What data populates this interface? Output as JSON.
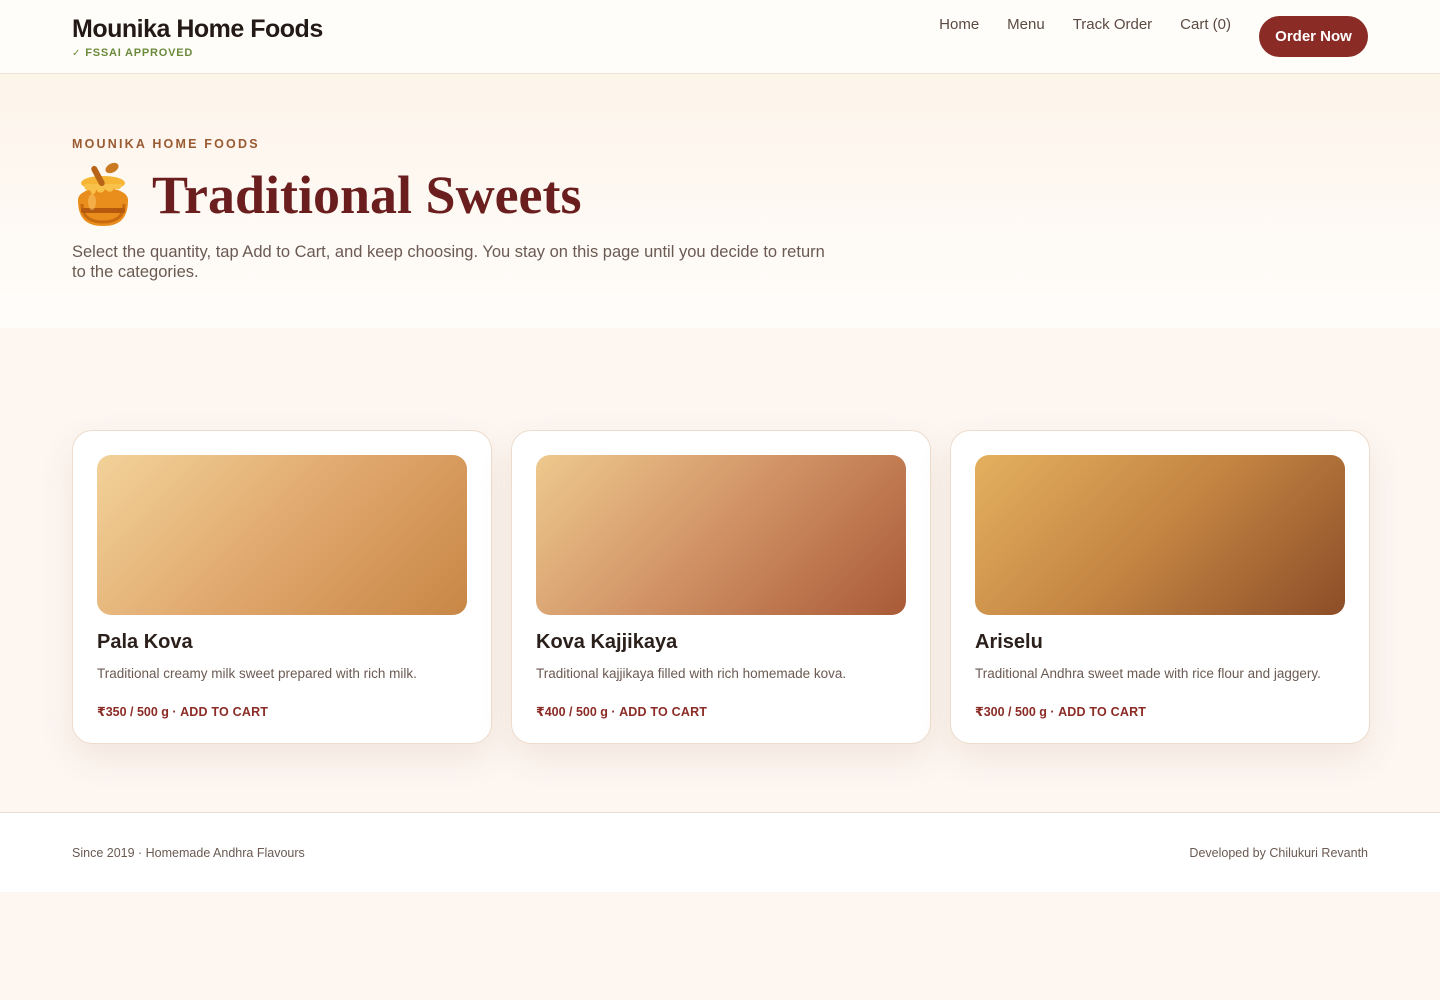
{
  "header": {
    "brand_name": "Mounika Home Foods",
    "badge": "FSSAI APPROVED",
    "nav": [
      "Home",
      "Menu",
      "Track Order",
      "Cart (0)"
    ],
    "cta": "Order Now"
  },
  "hero": {
    "eyebrow": "MOUNIKA HOME FOODS",
    "title": "Traditional Sweets",
    "icon": "honey-pot-icon",
    "description": "Select the quantity, tap Add to Cart, and keep choosing. You stay on this page until you decide to return to the categories."
  },
  "products": [
    {
      "name": "Pala Kova",
      "description": "Traditional creamy milk sweet prepared with rich milk.",
      "price": "₹350 / 500 g",
      "action": "ADD TO CART"
    },
    {
      "name": "Kova Kajjikaya",
      "description": "Traditional kajjikaya filled with rich homemade kova.",
      "price": "₹400 / 500 g",
      "action": "ADD TO CART"
    },
    {
      "name": "Ariselu",
      "description": "Traditional Andhra sweet made with rice flour and jaggery.",
      "price": "₹300 / 500 g",
      "action": "ADD TO CART"
    }
  ],
  "footer": {
    "left": "Since 2019 · Homemade Andhra Flavours",
    "right": "Developed by Chilukuri Revanth"
  },
  "colors": {
    "accent": "#8b2b25",
    "title": "#6a1e1e",
    "badge": "#6a8a3a",
    "eyebrow": "#9a5a32"
  }
}
